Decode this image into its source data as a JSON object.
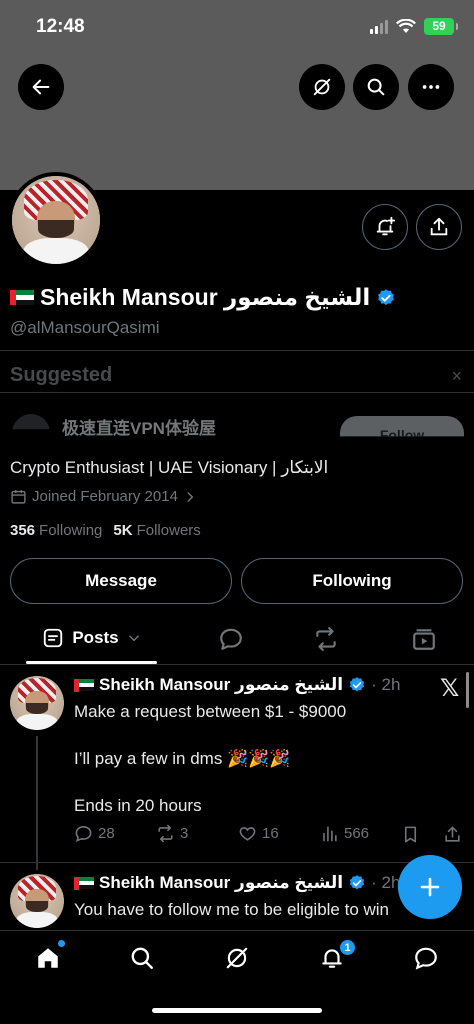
{
  "status_bar": {
    "time": "12:48",
    "battery": "59"
  },
  "profile": {
    "display_name": "Sheikh Mansour الشيخ منصور",
    "handle": "@alMansourQasimi",
    "bio": "Crypto Enthusiast | UAE Visionary | الابتكار",
    "joined": "Joined February 2014",
    "following_count": "356",
    "following_label": "Following",
    "followers_count": "5K",
    "followers_label": "Followers"
  },
  "suggested": {
    "title": "Suggested",
    "close_icon": "×",
    "item_name": "极速直连VPN体验屋",
    "follow_label": "Follow"
  },
  "buttons": {
    "message": "Message",
    "following": "Following"
  },
  "tabs": {
    "posts": "Posts"
  },
  "tweets": [
    {
      "author": "Sheikh Mansour الشيخ منصور",
      "time": "· 2h",
      "lines": [
        "Make a request between $1 - $9000",
        "I’ll pay a few in dms 🎉🎉🎉",
        "Ends in 20 hours"
      ],
      "replies": "28",
      "reposts": "3",
      "likes": "16",
      "views": "566",
      "source_logo": "𝕏"
    },
    {
      "author": "Sheikh Mansour الشيخ منصور",
      "time": "· 2h",
      "lines": [
        "You have to follow me to be eligible to win"
      ]
    }
  ],
  "nav": {
    "notifications_badge": "1"
  },
  "colors": {
    "accent": "#1d9bf0",
    "banner": "#5b5b5b",
    "uae_red": "#e0252f",
    "uae_green": "#00843d"
  }
}
